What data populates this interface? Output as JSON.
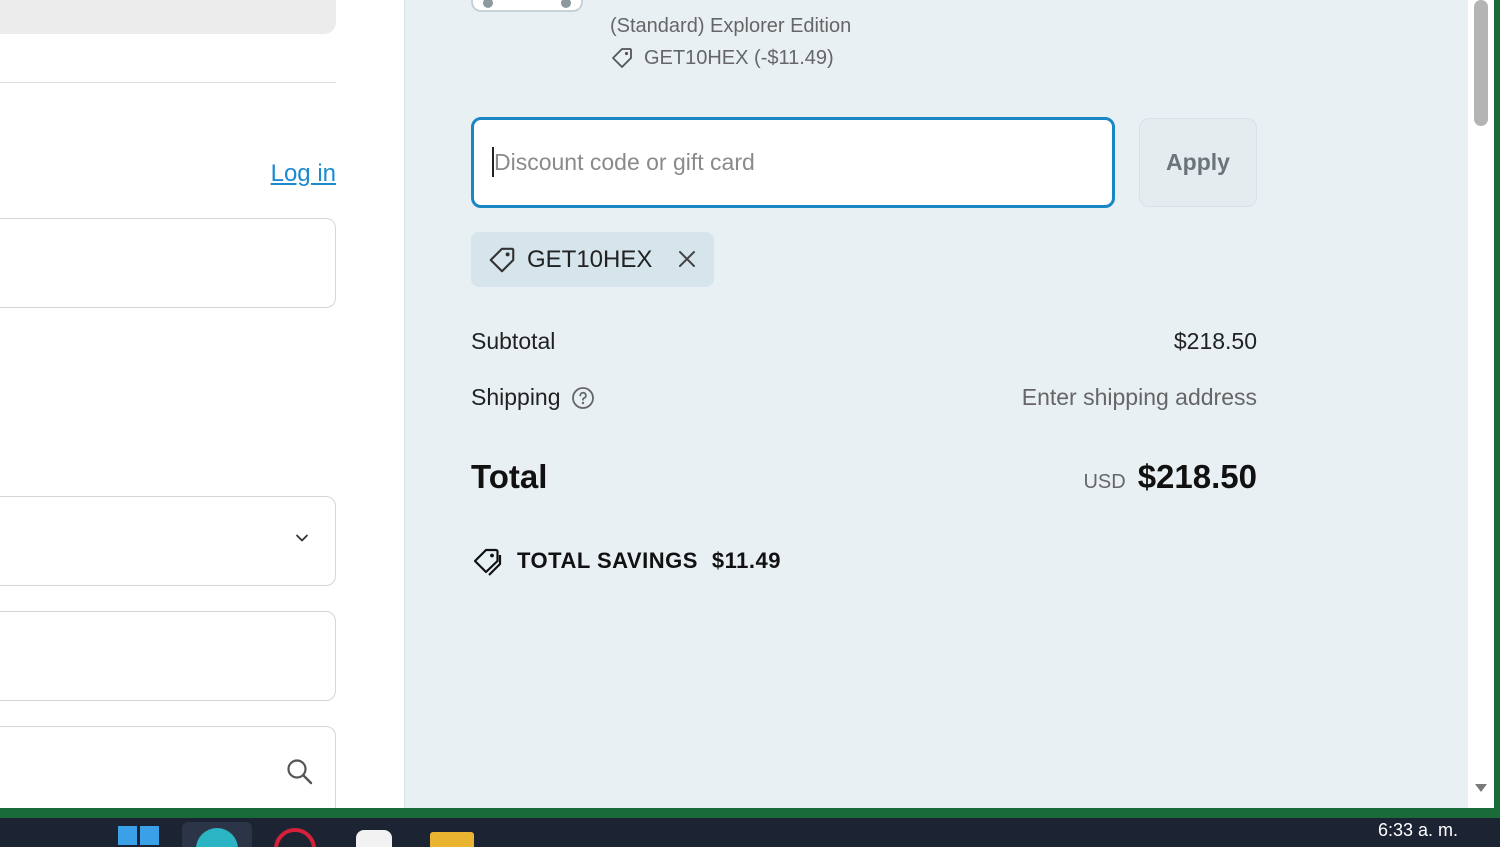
{
  "left_form": {
    "login_link": "Log in"
  },
  "order_summary": {
    "item": {
      "edition": "(Standard) Explorer Edition",
      "discount": "GET10HEX (-$11.49)"
    },
    "discount_input": {
      "placeholder": "Discount code or gift card",
      "value": ""
    },
    "apply_label": "Apply",
    "applied_code": "GET10HEX",
    "subtotal_label": "Subtotal",
    "subtotal_value": "$218.50",
    "shipping_label": "Shipping",
    "shipping_value": "Enter shipping address",
    "total_label": "Total",
    "total_currency": "USD",
    "total_value": "$218.50",
    "savings_label": "TOTAL SAVINGS",
    "savings_value": "$11.49"
  },
  "taskbar": {
    "clock": "6:33 a. m."
  },
  "colors": {
    "accent": "#1a87c4",
    "summary_bg": "#e8f0f4",
    "chip_bg": "#d6e4ec",
    "link": "#1c8ad0"
  },
  "icons": [
    "tag-icon",
    "close-icon",
    "help-icon",
    "chevron-down-icon",
    "search-icon",
    "savings-tag-icon"
  ]
}
